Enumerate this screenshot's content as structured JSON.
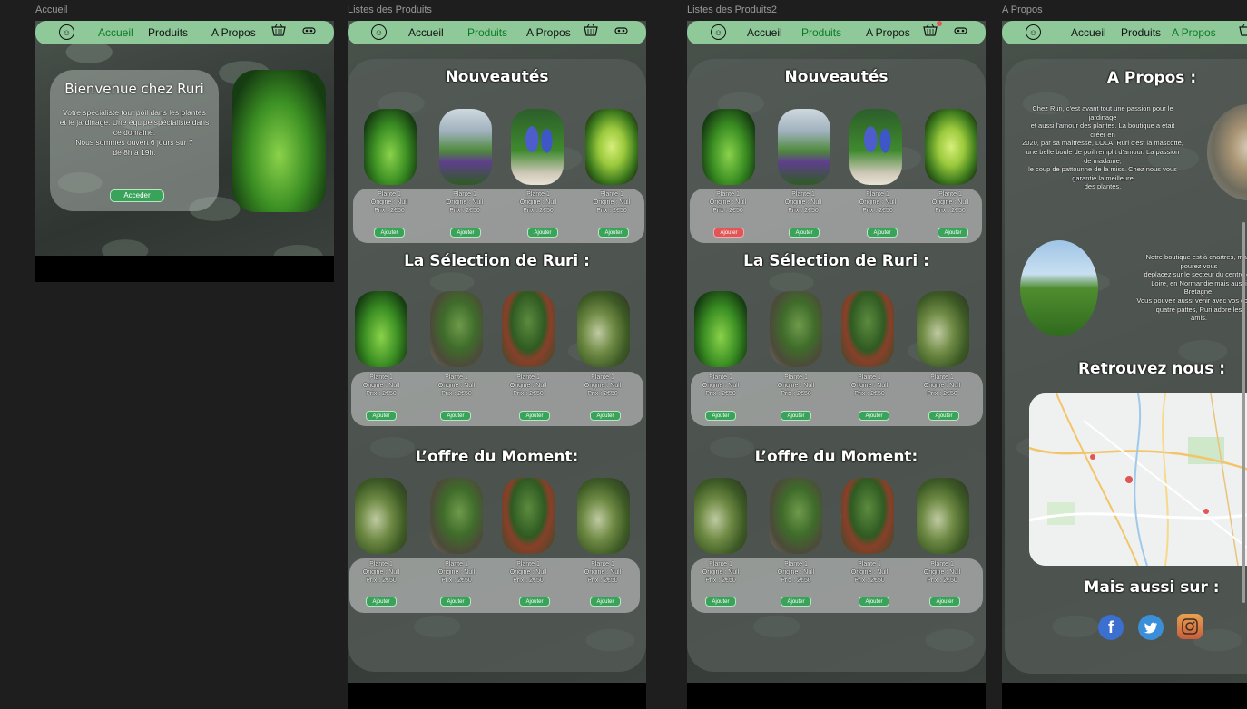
{
  "frames": {
    "accueil": "Accueil",
    "produits": "Listes des Produits",
    "produits2": "Listes des Produits2",
    "apropos": "A Propos"
  },
  "nav": {
    "accueil": "Accueil",
    "produits": "Produits",
    "apropos": "A Propos"
  },
  "home": {
    "title": "Bienvenue chez Ruri",
    "line1": "Votre spécialiste tout poil dans les plantes",
    "line2": "et le jardinage. Une équipe spécialiste dans",
    "line3": "ce domaine.",
    "line4": "Nous sommes ouvert 6 jours sur 7",
    "line5": "de 8h à 19h.",
    "button": "Acceder"
  },
  "sections": {
    "new": "Nouveautés",
    "selection": "La Sélection de Ruri :",
    "offer": "L’offre du Moment:"
  },
  "product": {
    "name": "Plante 1",
    "origin": "Origine : Null",
    "price": "Prix : 2€50",
    "add": "Ajouter"
  },
  "about": {
    "title": "A Propos :",
    "p1a": "Chez Ruri, c'est avant tout une passion pour le",
    "p1b": "jardinage",
    "p1c": "et aussi l'amour des plantes. La boutique a était",
    "p1d": "créer en",
    "p1e": "2020, par sa maîtresse, LOLA. Ruri c'est la mascotte,",
    "p1f": "une belle boule de poil remplit d'amour. La passion",
    "p1g": "de madame,",
    "p1h": "le coup de pattounne de la miss. Chez nous vous",
    "p1i": "garantie la meilleure",
    "p1j": "des plantes.",
    "p2a": "Notre boutique est à chartres, mais",
    "p2b": "pourez vous",
    "p2c": "deplacez sur le secteur du centre de",
    "p2d": "Loire, en Normandie mais aussi",
    "p2e": "Bretagne.",
    "p2f": "Vous pouvez aussi venir avec vos compa",
    "p2g": "quatre pattes, Ruri adore les",
    "p2h": "amis.",
    "find": "Retrouvez nous :",
    "also": "Mais aussi sur :"
  },
  "colors": {
    "nav": "#8fc99a",
    "active": "#0a7a22",
    "button": "#3aa35a",
    "accent_red": "#e05555"
  },
  "icons": [
    "logo-icon",
    "cart-icon",
    "sofa-icon",
    "facebook-icon",
    "twitter-icon",
    "instagram-icon"
  ]
}
